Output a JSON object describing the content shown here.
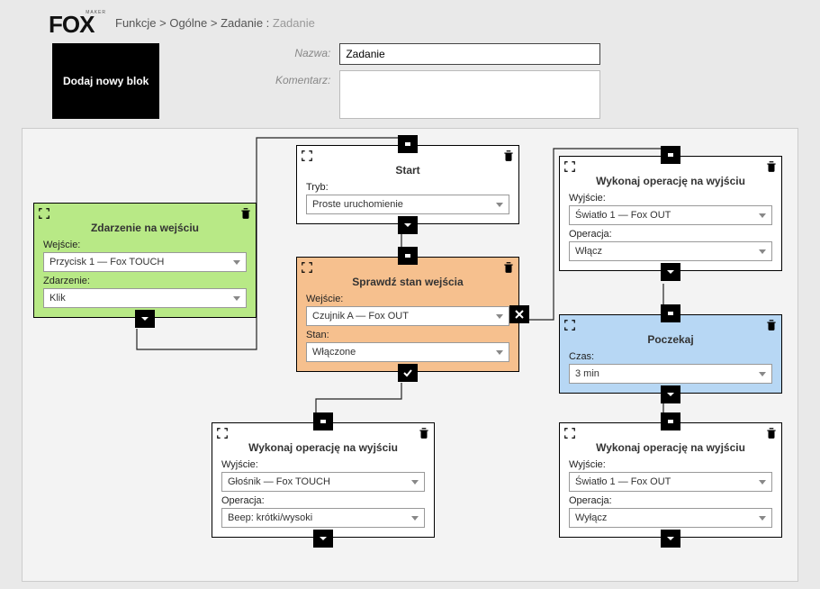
{
  "header": {
    "logo_text": "FOX",
    "logo_tag": "MAKER",
    "breadcrumb_prefix": "Funkcje > Ogólne > Zadanie : ",
    "breadcrumb_current": "Zadanie"
  },
  "toolbar": {
    "add_block": "Dodaj nowy blok"
  },
  "form": {
    "name_label": "Nazwa:",
    "name_value": "Zadanie",
    "comment_label": "Komentarz:",
    "comment_value": ""
  },
  "blocks": {
    "event_input": {
      "title": "Zdarzenie na wejściu",
      "input_label": "Wejście:",
      "input_value": "Przycisk 1 — Fox TOUCH",
      "event_label": "Zdarzenie:",
      "event_value": "Klik"
    },
    "start": {
      "title": "Start",
      "mode_label": "Tryb:",
      "mode_value": "Proste uruchomienie"
    },
    "check_input": {
      "title": "Sprawdź stan wejścia",
      "input_label": "Wejście:",
      "input_value": "Czujnik A — Fox OUT",
      "state_label": "Stan:",
      "state_value": "Włączone"
    },
    "op_true": {
      "title": "Wykonaj operację na wyjściu",
      "output_label": "Wyjście:",
      "output_value": "Głośnik — Fox TOUCH",
      "op_label": "Operacja:",
      "op_value": "Beep: krótki/wysoki"
    },
    "op_out1": {
      "title": "Wykonaj operację na wyjściu",
      "output_label": "Wyjście:",
      "output_value": "Światło 1 — Fox OUT",
      "op_label": "Operacja:",
      "op_value": "Włącz"
    },
    "wait": {
      "title": "Poczekaj",
      "time_label": "Czas:",
      "time_value": "3 min"
    },
    "op_out2": {
      "title": "Wykonaj operację na wyjściu",
      "output_label": "Wyjście:",
      "output_value": "Światło 1 — Fox OUT",
      "op_label": "Operacja:",
      "op_value": "Wyłącz"
    }
  }
}
